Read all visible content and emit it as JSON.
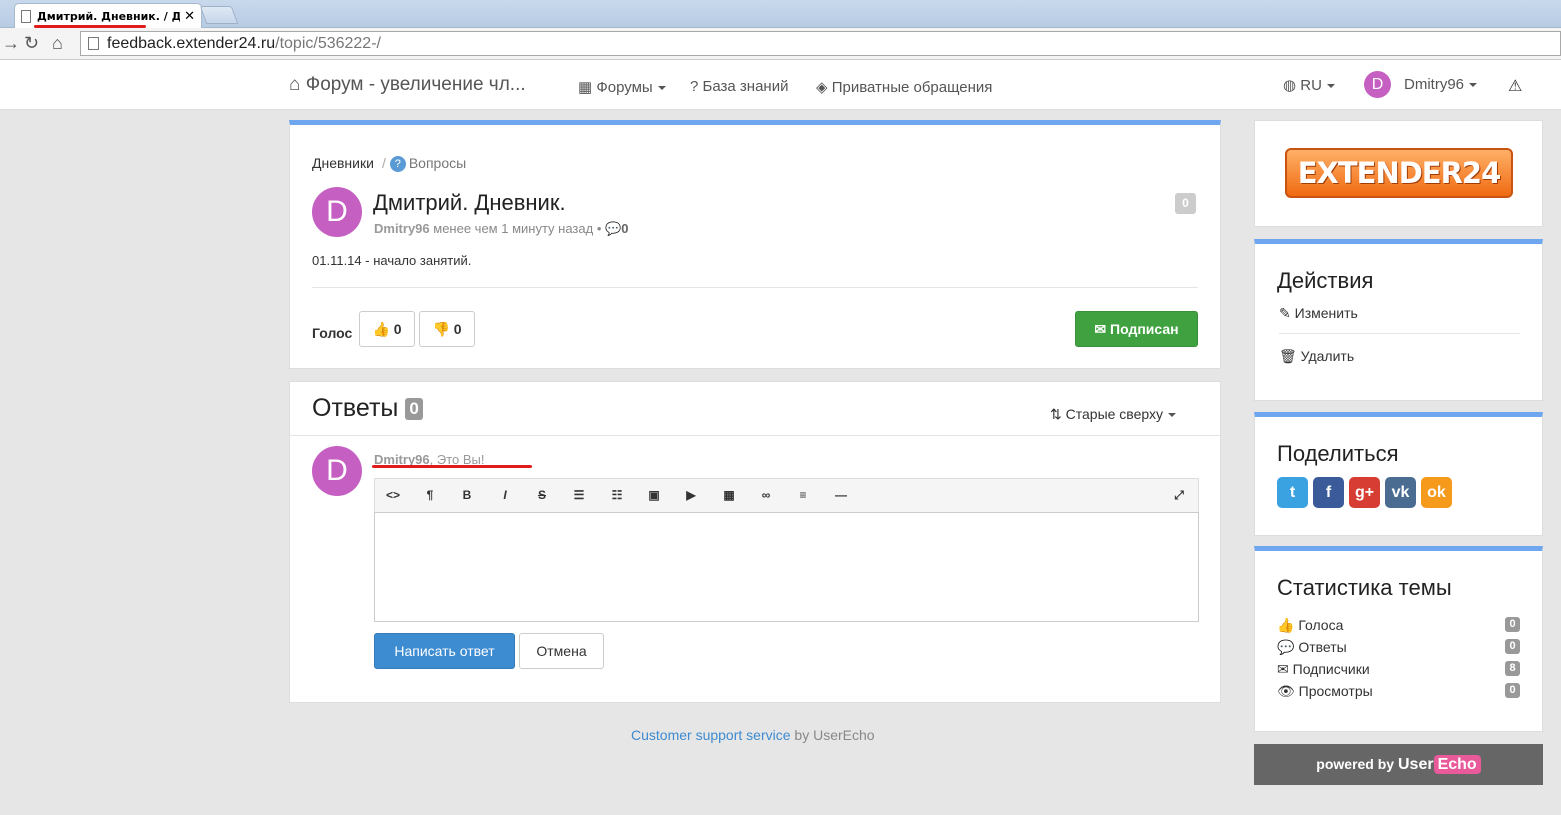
{
  "browser": {
    "tab_title": "Дмитрий. Дневник. / Дне",
    "url_host": "feedback.extender24.ru",
    "url_path": "/topic/536222-/"
  },
  "navbar": {
    "brand": "Форум - увеличение чл...",
    "forums": "Форумы",
    "knowledge": "База знаний",
    "private": "Приватные обращения",
    "lang": "RU",
    "avatar_letter": "D",
    "user": "Dmitry96"
  },
  "topic": {
    "breadcrumb_root": "Дневники",
    "breadcrumb_sep": "/",
    "breadcrumb_category": "Вопросы",
    "avatar_letter": "D",
    "title": "Дмитрий. Дневник.",
    "author": "Dmitry96",
    "time": "менее чем 1 минуту назад",
    "comments": "0",
    "count": "0",
    "body": "01.11.14 - начало занятий.",
    "vote_label": "Голос",
    "up_votes": "0",
    "down_votes": "0",
    "subscribe_label": "Подписан"
  },
  "answers": {
    "title": "Ответы",
    "count": "0",
    "sort_label": "Старые сверху",
    "avatar_letter": "D",
    "reply_user": "Dmitry96",
    "reply_note": ", Это Вы!",
    "submit_label": "Написать ответ",
    "cancel_label": "Отмена"
  },
  "footer": {
    "link": "Customer support service",
    "by": " by UserEcho"
  },
  "sidebar": {
    "logo_text": "EXTENDER24",
    "actions_title": "Действия",
    "edit_label": "Изменить",
    "delete_label": "Удалить",
    "share_title": "Поделиться",
    "stats_title": "Статистика темы",
    "stats": [
      {
        "label": "Голоса",
        "value": "0"
      },
      {
        "label": "Ответы",
        "value": "0"
      },
      {
        "label": "Подписчики",
        "value": "8"
      },
      {
        "label": "Просмотры",
        "value": "0"
      }
    ],
    "powered_by": "powered by",
    "powered_user": "User",
    "powered_echo": "Echo"
  },
  "colors": {
    "accent_blue": "#6fa6f0",
    "success_green": "#3fa13f",
    "avatar_purple": "#c65fc2",
    "annotation_red": "#e01b1b"
  }
}
